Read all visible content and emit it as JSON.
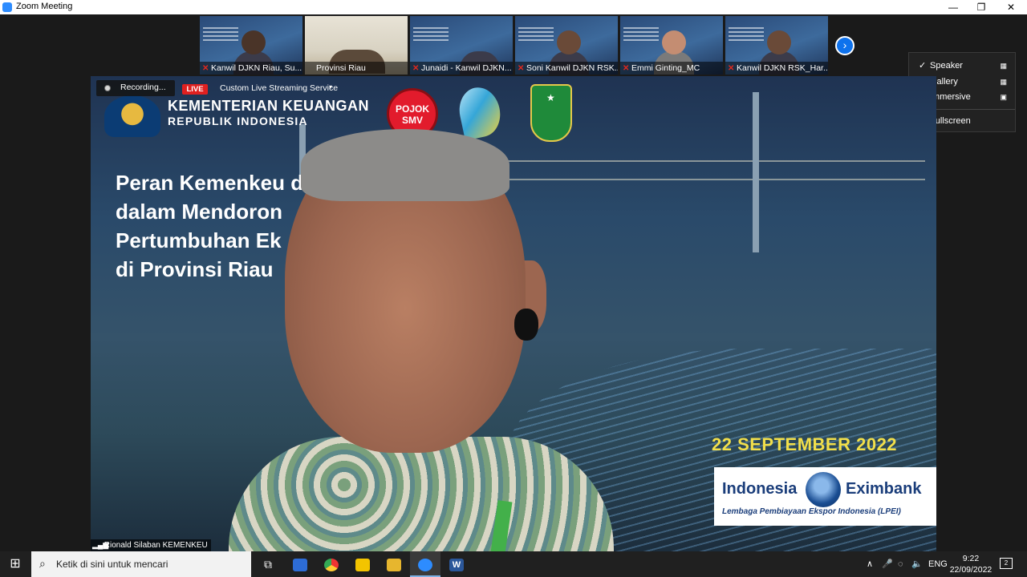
{
  "window": {
    "title": "Zoom Meeting",
    "minimize_glyph": "—",
    "restore_glyph": "❐",
    "close_glyph": "✕"
  },
  "thumbnails": [
    {
      "name": "Kanwil DJKN Riau, Su...",
      "muted": true,
      "style": "slide"
    },
    {
      "name": "Provinsi Riau",
      "muted": false,
      "style": "room"
    },
    {
      "name": "Junaidi - Kanwil DJKN...",
      "muted": true,
      "style": "slide"
    },
    {
      "name": "Soni Kanwil DJKN RSK...",
      "muted": true,
      "style": "slide"
    },
    {
      "name": "Emmi Ginting_MC",
      "muted": true,
      "style": "slide"
    },
    {
      "name": "Kanwil DJKN RSK_Har...",
      "muted": true,
      "style": "slide"
    }
  ],
  "next_page_glyph": "›",
  "view_menu": {
    "items": [
      {
        "label": "Speaker",
        "checked": true,
        "icon": "speaker-view-icon"
      },
      {
        "label": "Gallery",
        "checked": false,
        "icon": "gallery-grid-icon"
      },
      {
        "label": "Immersive",
        "checked": false,
        "icon": "immersive-view-icon"
      }
    ],
    "fullscreen_label": "Fullscreen",
    "check_glyph": "✓"
  },
  "recording": {
    "status": "Recording...",
    "live_label": "LIVE",
    "stream_service": "Custom Live Streaming Service",
    "caret": "▾"
  },
  "slide": {
    "org_name": "KEMENTERIAN KEUANGAN",
    "org_sub": "REPUBLIK INDONESIA",
    "pojok_line1": "POJOK",
    "pojok_line2": "SMV",
    "title_lines": [
      "Peran Kemenkeu d",
      "dalam Mendoron",
      "Pertumbuhan Ek",
      "di Provinsi Riau"
    ],
    "date": "22 SEPTEMBER 2022",
    "sponsor_left": "Indonesia",
    "sponsor_right": "Eximbank",
    "sponsor_tagline": "Lembaga Pembiayaan Ekspor Indonesia (LPEI)"
  },
  "active_speaker": {
    "name": "Rionald Silaban KEMENKEU",
    "signal_glyph": "▂▄▆"
  },
  "taskbar": {
    "start_glyph": "⊞",
    "search_placeholder": "Ketik di sini untuk mencari",
    "search_glyph": "⌕",
    "apps": [
      {
        "name": "task-view",
        "glyph": "⧉"
      },
      {
        "name": "zoom-launcher",
        "glyph": ""
      },
      {
        "name": "chrome",
        "glyph": ""
      },
      {
        "name": "sticky-notes",
        "glyph": ""
      },
      {
        "name": "file-explorer",
        "glyph": ""
      },
      {
        "name": "zoom",
        "glyph": ""
      },
      {
        "name": "word",
        "glyph": "W"
      }
    ],
    "tray": {
      "chevron": "∧",
      "mic": "🎤",
      "wifi": "◌",
      "volume": "🔈",
      "language": "ENG"
    },
    "time": "9:22",
    "date": "22/09/2022",
    "notification_count": "2"
  },
  "colors": {
    "zoom_blue": "#2d8cff",
    "live_red": "#e02020",
    "date_yellow": "#f2df4a",
    "next_btn": "#0e72ed"
  }
}
